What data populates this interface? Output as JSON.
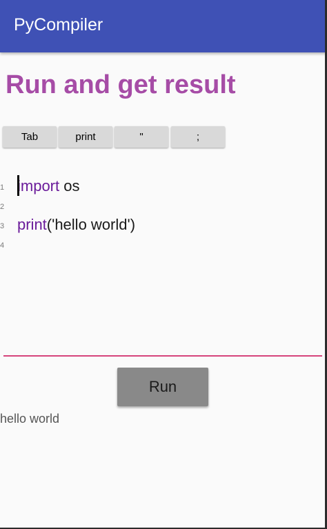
{
  "app_bar": {
    "title": "PyCompiler",
    "color": "#3f51b5"
  },
  "headline": {
    "text": "Run and get result",
    "color": "#a64ca6"
  },
  "toolbar": {
    "keys": [
      {
        "label": "Tab"
      },
      {
        "label": "print"
      },
      {
        "label": "\""
      },
      {
        "label": ";"
      }
    ]
  },
  "editor": {
    "line_numbers": [
      "1",
      "2",
      "3",
      "4"
    ],
    "lines": [
      {
        "keyword": "import",
        "rest": " os"
      },
      {
        "keyword": "",
        "rest": ""
      },
      {
        "keyword": "print",
        "rest": "('hello world')"
      }
    ],
    "keyword_color": "#6a1b9a",
    "underline_color": "#d6437a"
  },
  "run_button": {
    "label": "Run"
  },
  "output": {
    "text": "hello world"
  }
}
